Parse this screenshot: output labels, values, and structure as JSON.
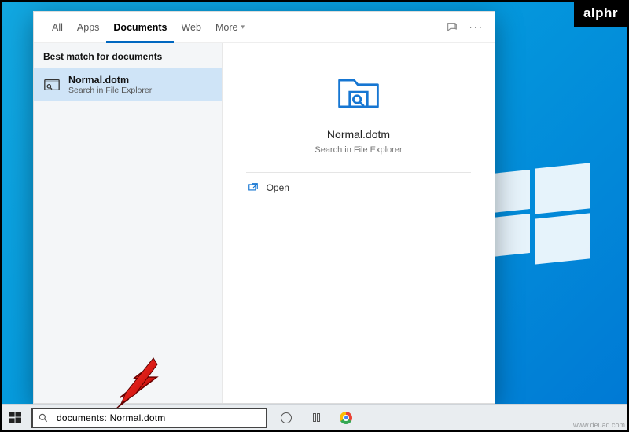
{
  "badge": "alphr",
  "watermark": "www.deuaq.com",
  "tabs": {
    "all": "All",
    "apps": "Apps",
    "documents": "Documents",
    "web": "Web",
    "more": "More"
  },
  "left": {
    "section": "Best match for documents",
    "result": {
      "title": "Normal.dotm",
      "subtitle": "Search in File Explorer"
    }
  },
  "right": {
    "title": "Normal.dotm",
    "subtitle": "Search in File Explorer",
    "open": "Open"
  },
  "search": {
    "value": "documents: Normal.dotm"
  }
}
